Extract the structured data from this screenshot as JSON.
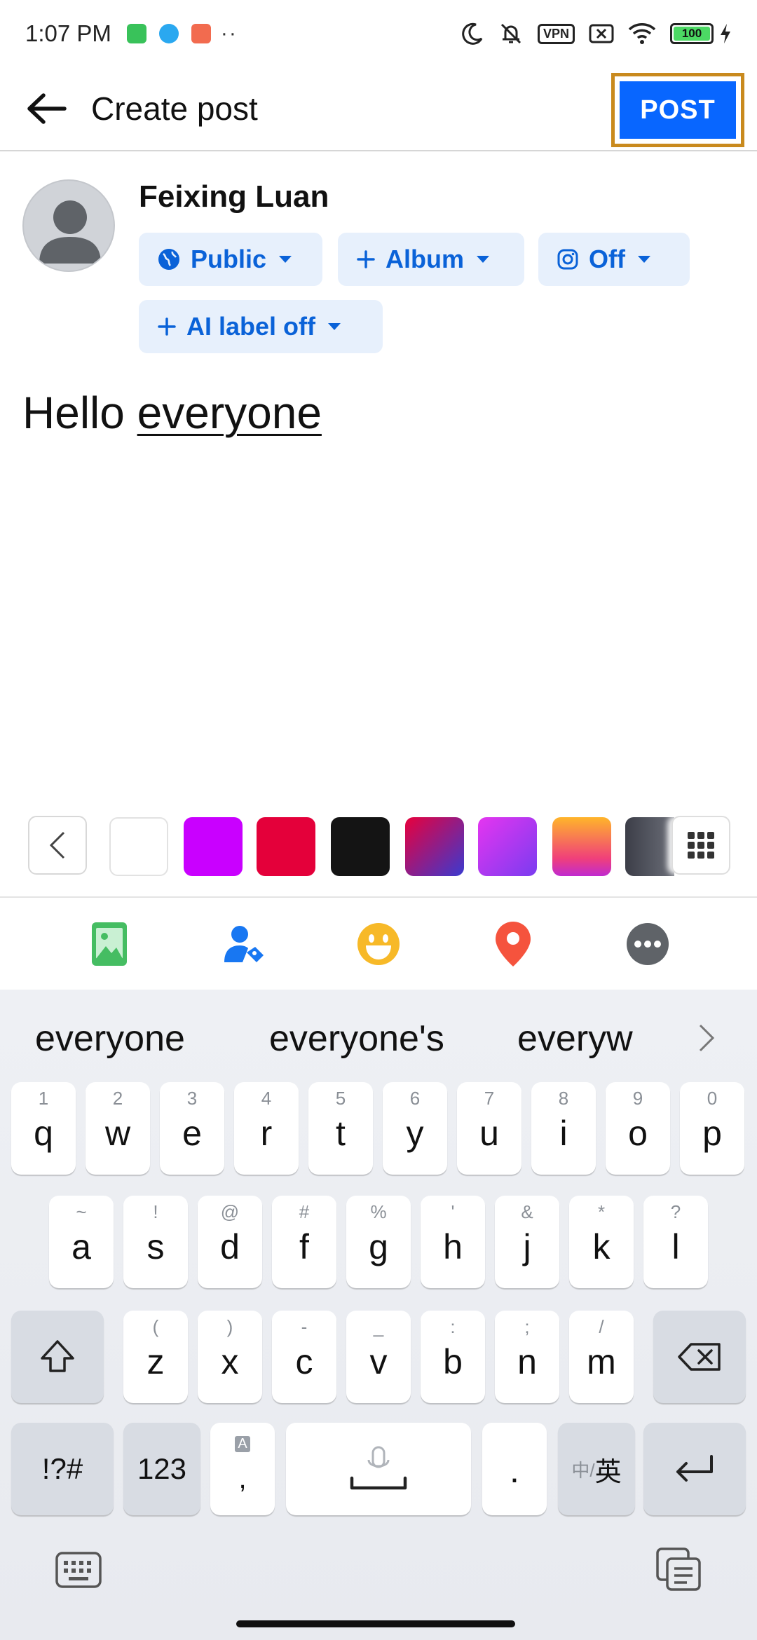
{
  "status_bar": {
    "time": "1:07 PM",
    "dots": "··",
    "vpn": "VPN",
    "battery": "100"
  },
  "app_bar": {
    "title": "Create post",
    "post_label": "POST"
  },
  "composer": {
    "user_name": "Feixing Luan",
    "chips": {
      "audience": "Public",
      "album": "Album",
      "instagram": "Off",
      "ai_label": "AI label off"
    },
    "text_plain": "Hello ",
    "text_underlined": "everyone"
  },
  "background_colors": [
    "#ffffff",
    "#c900ff",
    "#e4003a",
    "#141414",
    "gradient-red-blue",
    "gradient-purple-pink",
    "gradient-orange-pink",
    "gradient-dark"
  ],
  "attachment_icons": [
    "photo-icon",
    "tag-people-icon",
    "feeling-icon",
    "location-icon",
    "more-icon"
  ],
  "keyboard": {
    "suggestions": [
      "everyone",
      "everyone's",
      "everyw"
    ],
    "row1": [
      {
        "key": "q",
        "hint": "1"
      },
      {
        "key": "w",
        "hint": "2"
      },
      {
        "key": "e",
        "hint": "3"
      },
      {
        "key": "r",
        "hint": "4"
      },
      {
        "key": "t",
        "hint": "5"
      },
      {
        "key": "y",
        "hint": "6"
      },
      {
        "key": "u",
        "hint": "7"
      },
      {
        "key": "i",
        "hint": "8"
      },
      {
        "key": "o",
        "hint": "9"
      },
      {
        "key": "p",
        "hint": "0"
      }
    ],
    "row2": [
      {
        "key": "a",
        "hint": "~"
      },
      {
        "key": "s",
        "hint": "!"
      },
      {
        "key": "d",
        "hint": "@"
      },
      {
        "key": "f",
        "hint": "#"
      },
      {
        "key": "g",
        "hint": "%"
      },
      {
        "key": "h",
        "hint": "'"
      },
      {
        "key": "j",
        "hint": "&"
      },
      {
        "key": "k",
        "hint": "*"
      },
      {
        "key": "l",
        "hint": "?"
      }
    ],
    "row3": [
      {
        "key": "z",
        "hint": "("
      },
      {
        "key": "x",
        "hint": ")"
      },
      {
        "key": "c",
        "hint": "-"
      },
      {
        "key": "v",
        "hint": "_"
      },
      {
        "key": "b",
        "hint": ":"
      },
      {
        "key": "n",
        "hint": ";"
      },
      {
        "key": "m",
        "hint": "/"
      }
    ],
    "symbols_label": "!?#",
    "numbers_label": "123",
    "comma_label": ",",
    "comma_hint": "A",
    "period_label": ".",
    "lang_label_small": "中/",
    "lang_label": "英"
  }
}
